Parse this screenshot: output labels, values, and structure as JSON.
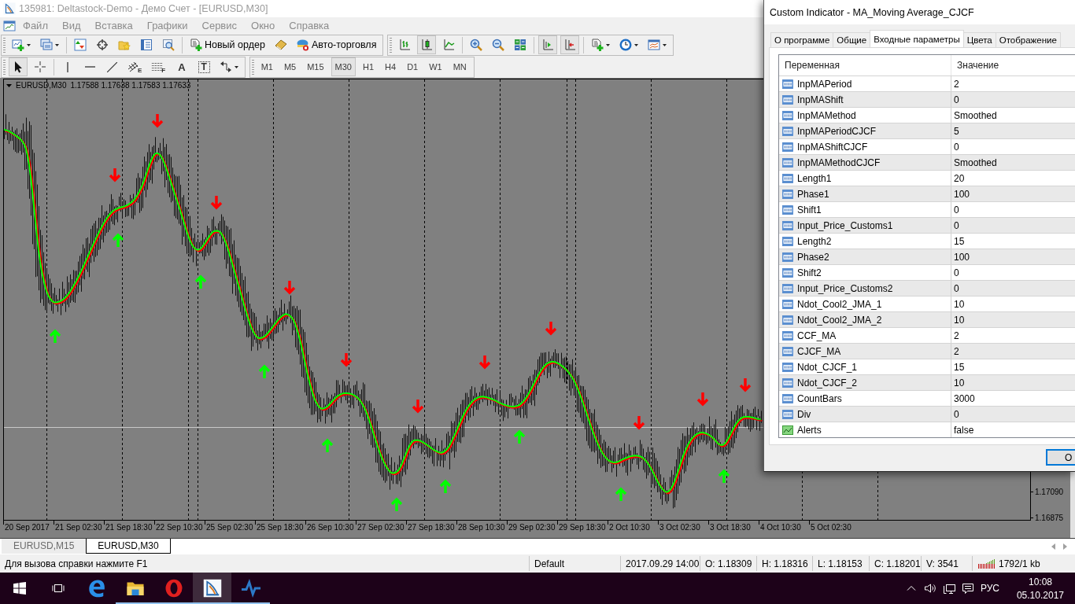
{
  "window": {
    "title": "135981: Deltastock-Demo - Демо Счет - [EURUSD,M30]"
  },
  "menu": [
    "Файл",
    "Вид",
    "Вставка",
    "Графики",
    "Сервис",
    "Окно",
    "Справка"
  ],
  "toolbar_rows": [
    [
      {
        "groups": [
          [
            {
              "kind": "new-chart",
              "selected": false
            },
            {
              "kind": "profiles",
              "selected": false
            }
          ],
          [
            {
              "kind": "market-watch",
              "selected": false
            },
            {
              "kind": "navigator",
              "selected": false
            },
            {
              "kind": "favorites",
              "selected": false
            },
            {
              "kind": "data-window",
              "selected": false
            },
            {
              "kind": "tester",
              "selected": false
            }
          ],
          [
            {
              "kind": "new-order",
              "label": "Новый ордер",
              "selected": false
            },
            {
              "kind": "editor",
              "selected": false
            },
            {
              "kind": "auto-trading",
              "label": "Авто-торговля",
              "selected": false
            }
          ]
        ]
      },
      {
        "groups": [
          [
            {
              "kind": "bar-chart",
              "selected": false
            },
            {
              "kind": "candle-chart",
              "selected": true
            },
            {
              "kind": "line-chart",
              "selected": false
            }
          ],
          [
            {
              "kind": "zoom-in",
              "selected": false
            },
            {
              "kind": "zoom-out",
              "selected": false
            },
            {
              "kind": "tile",
              "selected": false
            }
          ],
          [
            {
              "kind": "autoscroll",
              "selected": true
            },
            {
              "kind": "chart-shift",
              "selected": true
            }
          ],
          [
            {
              "kind": "indicators",
              "selected": false
            },
            {
              "kind": "periods",
              "selected": false
            },
            {
              "kind": "templates",
              "selected": false
            }
          ]
        ]
      }
    ],
    [
      {
        "groups": [
          [
            {
              "kind": "cursor",
              "selected": true
            },
            {
              "kind": "crosshair",
              "selected": false
            }
          ],
          [
            {
              "kind": "vline",
              "selected": false
            },
            {
              "kind": "hline",
              "selected": false
            },
            {
              "kind": "trend",
              "selected": false
            },
            {
              "kind": "channel",
              "label": "E",
              "selected": false
            },
            {
              "kind": "fibo",
              "label": "F",
              "selected": false
            },
            {
              "kind": "text-tool",
              "label": "A",
              "selected": false
            },
            {
              "kind": "label-tool",
              "label": "T",
              "selected": false
            },
            {
              "kind": "arrows",
              "selected": false
            }
          ]
        ]
      },
      {
        "groups": [
          [
            {
              "kind": "period",
              "label": "M1",
              "selected": false
            },
            {
              "kind": "period",
              "label": "M5",
              "selected": false
            },
            {
              "kind": "period",
              "label": "M15",
              "selected": false
            },
            {
              "kind": "period",
              "label": "M30",
              "selected": true
            },
            {
              "kind": "period",
              "label": "H1",
              "selected": false
            },
            {
              "kind": "period",
              "label": "H4",
              "selected": false
            },
            {
              "kind": "period",
              "label": "D1",
              "selected": false
            },
            {
              "kind": "period",
              "label": "W1",
              "selected": false
            },
            {
              "kind": "period",
              "label": "MN",
              "selected": false
            }
          ]
        ]
      }
    ]
  ],
  "chart": {
    "symbol": "EURUSD,M30",
    "quote": "1.17588 1.17638 1.17583 1.17633",
    "price_labels": [
      "1.17090",
      "1.16875"
    ],
    "time_labels": [
      "20 Sep 2017",
      "21 Sep 02:30",
      "21 Sep 18:30",
      "22 Sep 10:30",
      "25 Sep 02:30",
      "25 Sep 18:30",
      "26 Sep 10:30",
      "27 Sep 02:30",
      "27 Sep 18:30",
      "28 Sep 10:30",
      "29 Sep 02:30",
      "29 Sep 18:30",
      "2 Oct 10:30",
      "3 Oct 02:30",
      "3 Oct 18:30",
      "4 Oct 10:30",
      "5 Oct 02:30"
    ]
  },
  "dialog": {
    "title": "Custom Indicator - MA_Moving Average_CJCF",
    "tabs": [
      {
        "label": "О программе",
        "selected": false
      },
      {
        "label": "Общие",
        "selected": false
      },
      {
        "label": "Входные параметры",
        "selected": true
      },
      {
        "label": "Цвета",
        "selected": false
      },
      {
        "label": "Отображение",
        "selected": false
      }
    ],
    "table": {
      "columns": [
        "Переменная",
        "Значение"
      ],
      "rows": [
        {
          "kind": "number",
          "name": "InpMAPeriod",
          "value": "2"
        },
        {
          "kind": "number",
          "name": "InpMAShift",
          "value": "0"
        },
        {
          "kind": "number",
          "name": "InpMAMethod",
          "value": "Smoothed"
        },
        {
          "kind": "number",
          "name": "InpMAPeriodCJCF",
          "value": "5"
        },
        {
          "kind": "number",
          "name": "InpMAShiftCJCF",
          "value": "0"
        },
        {
          "kind": "number",
          "name": "InpMAMethodCJCF",
          "value": "Smoothed"
        },
        {
          "kind": "number",
          "name": "Length1",
          "value": "20"
        },
        {
          "kind": "number",
          "name": "Phase1",
          "value": "100"
        },
        {
          "kind": "number",
          "name": "Shift1",
          "value": "0"
        },
        {
          "kind": "number",
          "name": "Input_Price_Customs1",
          "value": "0"
        },
        {
          "kind": "number",
          "name": "Length2",
          "value": "15"
        },
        {
          "kind": "number",
          "name": "Phase2",
          "value": "100"
        },
        {
          "kind": "number",
          "name": "Shift2",
          "value": "0"
        },
        {
          "kind": "number",
          "name": "Input_Price_Customs2",
          "value": "0"
        },
        {
          "kind": "number",
          "name": "Ndot_Cool2_JMA_1",
          "value": "10"
        },
        {
          "kind": "number",
          "name": "Ndot_Cool2_JMA_2",
          "value": "10"
        },
        {
          "kind": "number",
          "name": "CCF_MA",
          "value": "2"
        },
        {
          "kind": "number",
          "name": "CJCF_MA",
          "value": "2"
        },
        {
          "kind": "number",
          "name": "Ndot_CJCF_1",
          "value": "15"
        },
        {
          "kind": "number",
          "name": "Ndot_CJCF_2",
          "value": "10"
        },
        {
          "kind": "number",
          "name": "CountBars",
          "value": "3000"
        },
        {
          "kind": "number",
          "name": "Div",
          "value": "0"
        },
        {
          "kind": "bool",
          "name": "Alerts",
          "value": "false"
        }
      ]
    },
    "buttons": [
      "O"
    ]
  },
  "chart_tabs": [
    {
      "label": "EURUSD,M15",
      "selected": false
    },
    {
      "label": "EURUSD,M30",
      "selected": true
    }
  ],
  "status_bar": {
    "help": "Для вызова справки нажмите F1",
    "profile": "Default",
    "time": "2017.09.29 14:00",
    "open": "O: 1.18309",
    "high": "H: 1.18316",
    "low": "L: 1.18153",
    "close": "C: 1.18201",
    "volume": "V: 3541",
    "traffic": "1792/1 kb"
  },
  "taskbar": {
    "apps": [
      {
        "kind": "edge",
        "running": false,
        "selected": false
      },
      {
        "kind": "explorer",
        "running": true,
        "selected": false
      },
      {
        "kind": "opera",
        "running": true,
        "selected": false
      },
      {
        "kind": "metatrader",
        "running": true,
        "selected": true
      },
      {
        "kind": "pulse",
        "running": true,
        "selected": false
      }
    ],
    "language": "РУС",
    "time": "10:08",
    "date": "05.10.2017"
  }
}
